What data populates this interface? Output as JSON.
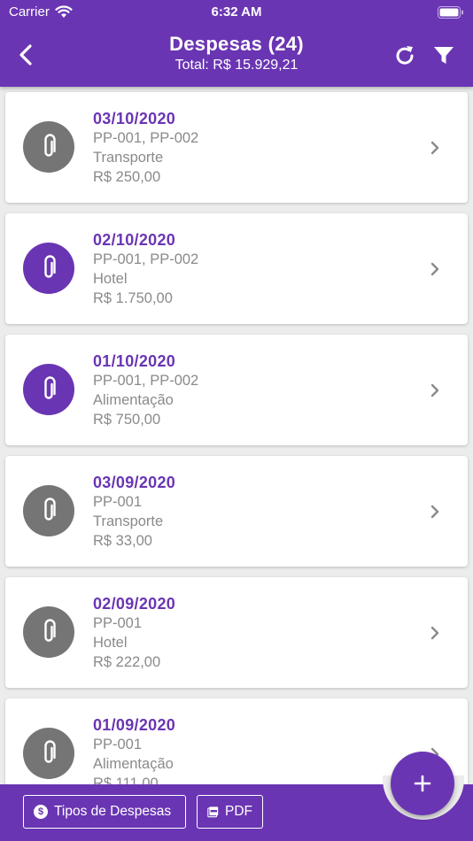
{
  "status": {
    "carrier": "Carrier",
    "time": "6:32 AM"
  },
  "header": {
    "title": "Despesas (24)",
    "subtitle": "Total: R$ 15.929,21"
  },
  "expenses": [
    {
      "date": "03/10/2020",
      "refs": "PP-001, PP-002",
      "category": "Transporte",
      "amount": "R$ 250,00",
      "has_attachment": false
    },
    {
      "date": "02/10/2020",
      "refs": "PP-001, PP-002",
      "category": "Hotel",
      "amount": "R$ 1.750,00",
      "has_attachment": true
    },
    {
      "date": "01/10/2020",
      "refs": "PP-001, PP-002",
      "category": "Alimentação",
      "amount": "R$ 750,00",
      "has_attachment": true
    },
    {
      "date": "03/09/2020",
      "refs": "PP-001",
      "category": "Transporte",
      "amount": "R$ 33,00",
      "has_attachment": false
    },
    {
      "date": "02/09/2020",
      "refs": "PP-001",
      "category": "Hotel",
      "amount": "R$ 222,00",
      "has_attachment": false
    },
    {
      "date": "01/09/2020",
      "refs": "PP-001",
      "category": "Alimentação",
      "amount": "R$ 111,00",
      "has_attachment": false
    }
  ],
  "footer": {
    "types_label": "Tipos de Despesas",
    "pdf_label": "PDF"
  },
  "colors": {
    "accent": "#6a35b3",
    "icon_inactive": "#757575",
    "secondary_text": "#8a8a8a"
  },
  "icons": [
    "wifi-icon",
    "battery-icon",
    "back-arrow-icon",
    "refresh-icon",
    "filter-icon",
    "paperclip-icon",
    "chevron-right-icon",
    "dollar-icon",
    "pdf-icon",
    "plus-icon"
  ]
}
